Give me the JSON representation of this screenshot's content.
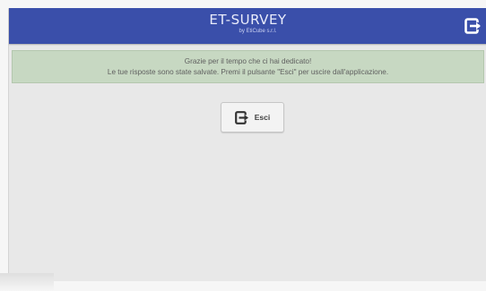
{
  "header": {
    "title": "ET-SURVEY",
    "subtitle": "by EtiCube s.r.l.",
    "exit_icon": "exit-icon"
  },
  "message": {
    "line1": "Grazie per il tempo che ci hai dedicato!",
    "line2": "Le tue risposte sono state salvate. Premi il pulsante \"Esci\" per uscire dall'applicazione."
  },
  "exit_button": {
    "label": "Esci",
    "icon": "exit-icon"
  },
  "colors": {
    "header_bg": "#3a4faa",
    "message_bg": "#c7d8c2",
    "panel_bg": "#e8e8e8"
  }
}
